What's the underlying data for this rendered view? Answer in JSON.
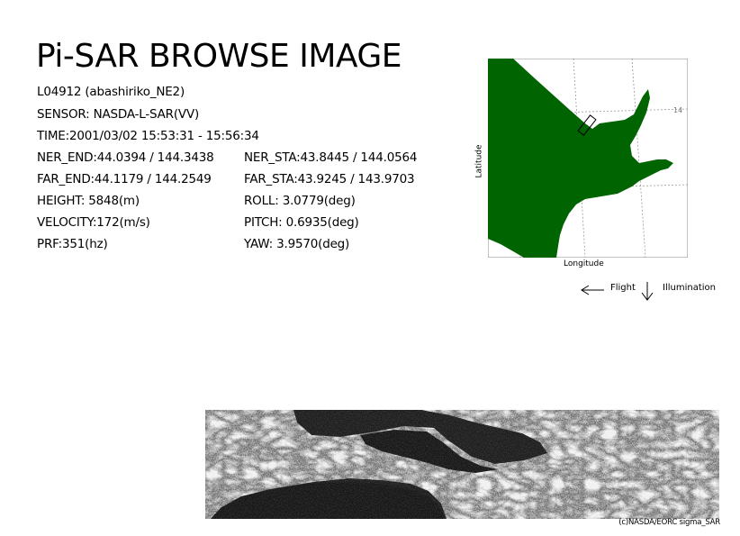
{
  "header": {
    "title": "Pi-SAR BROWSE IMAGE"
  },
  "info": {
    "scene": "L04912 (abashiriko_NE2)",
    "sensor": "SENSOR: NASDA-L-SAR(VV)",
    "time": "TIME:2001/03/02  15:53:31 - 15:56:34",
    "ner_end": "NER_END:44.0394 / 144.3438",
    "ner_sta": "NER_STA:43.8445 / 144.0564",
    "far_end": "FAR_END:44.1179 / 144.2549",
    "far_sta": "FAR_STA:43.9245 / 143.9703",
    "height": "HEIGHT: 5848(m)",
    "roll": "ROLL: 3.0779(deg)",
    "velocity": "VELOCITY:172(m/s)",
    "pitch": "PITCH: 0.6935(deg)",
    "prf": "PRF:351(hz)",
    "yaw": "YAW:  3.9570(deg)"
  },
  "map": {
    "ylabel": "Latitude",
    "xlabel": "Longitude",
    "tick": "14",
    "land_color": "#006400",
    "sea_color": "#ffffff"
  },
  "legend": {
    "flight": "Flight",
    "illumination": "Illumination",
    "flight_icon": "arrow-left-icon",
    "illumination_icon": "arrow-down-icon"
  },
  "footer": {
    "credit": "(c)NASDA/EORC sigma_SAR"
  }
}
